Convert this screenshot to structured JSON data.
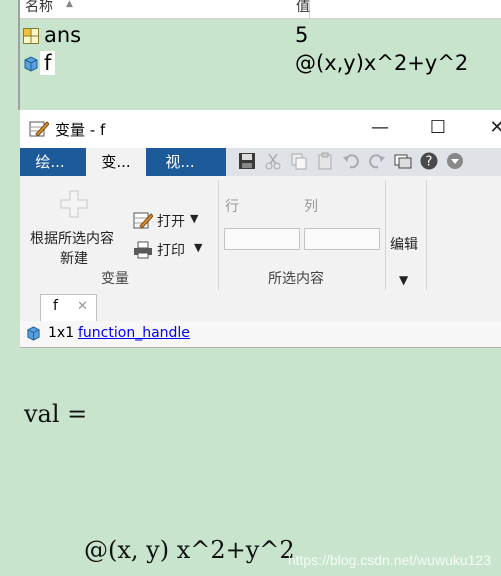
{
  "workspace": {
    "headers": {
      "name": "名称",
      "value": "值"
    },
    "rows": [
      {
        "name": "ans",
        "value": "5",
        "icon": "matrix-icon"
      },
      {
        "name": "f",
        "value": "@(x,y)x^2+y^2",
        "icon": "function-handle-icon"
      }
    ]
  },
  "window": {
    "title": "变量 - f",
    "controls": {
      "minimize": "—",
      "maximize": "☐",
      "close": "✕"
    }
  },
  "tabs": [
    "绘...",
    "变...",
    "视..."
  ],
  "ribbon": {
    "new_from_selection_line1": "根据所选内容",
    "new_from_selection_line2": "新建",
    "open": "打开",
    "print": "打印",
    "section_variable": "变量",
    "row_label": "行",
    "col_label": "列",
    "section_selection": "所选内容",
    "edit": "编辑"
  },
  "doc_tab": {
    "label": "f",
    "close": "✕"
  },
  "info": {
    "size": "1x1",
    "class": "function_handle"
  },
  "output": {
    "line1": "val =",
    "line2": "@(x, y) x^2+y^2"
  },
  "watermark": "https://blog.csdn.net/wuwuku123",
  "colors": {
    "background": "#c8e4cc",
    "tabbar": "#1d5a99",
    "link": "#0000ee"
  }
}
